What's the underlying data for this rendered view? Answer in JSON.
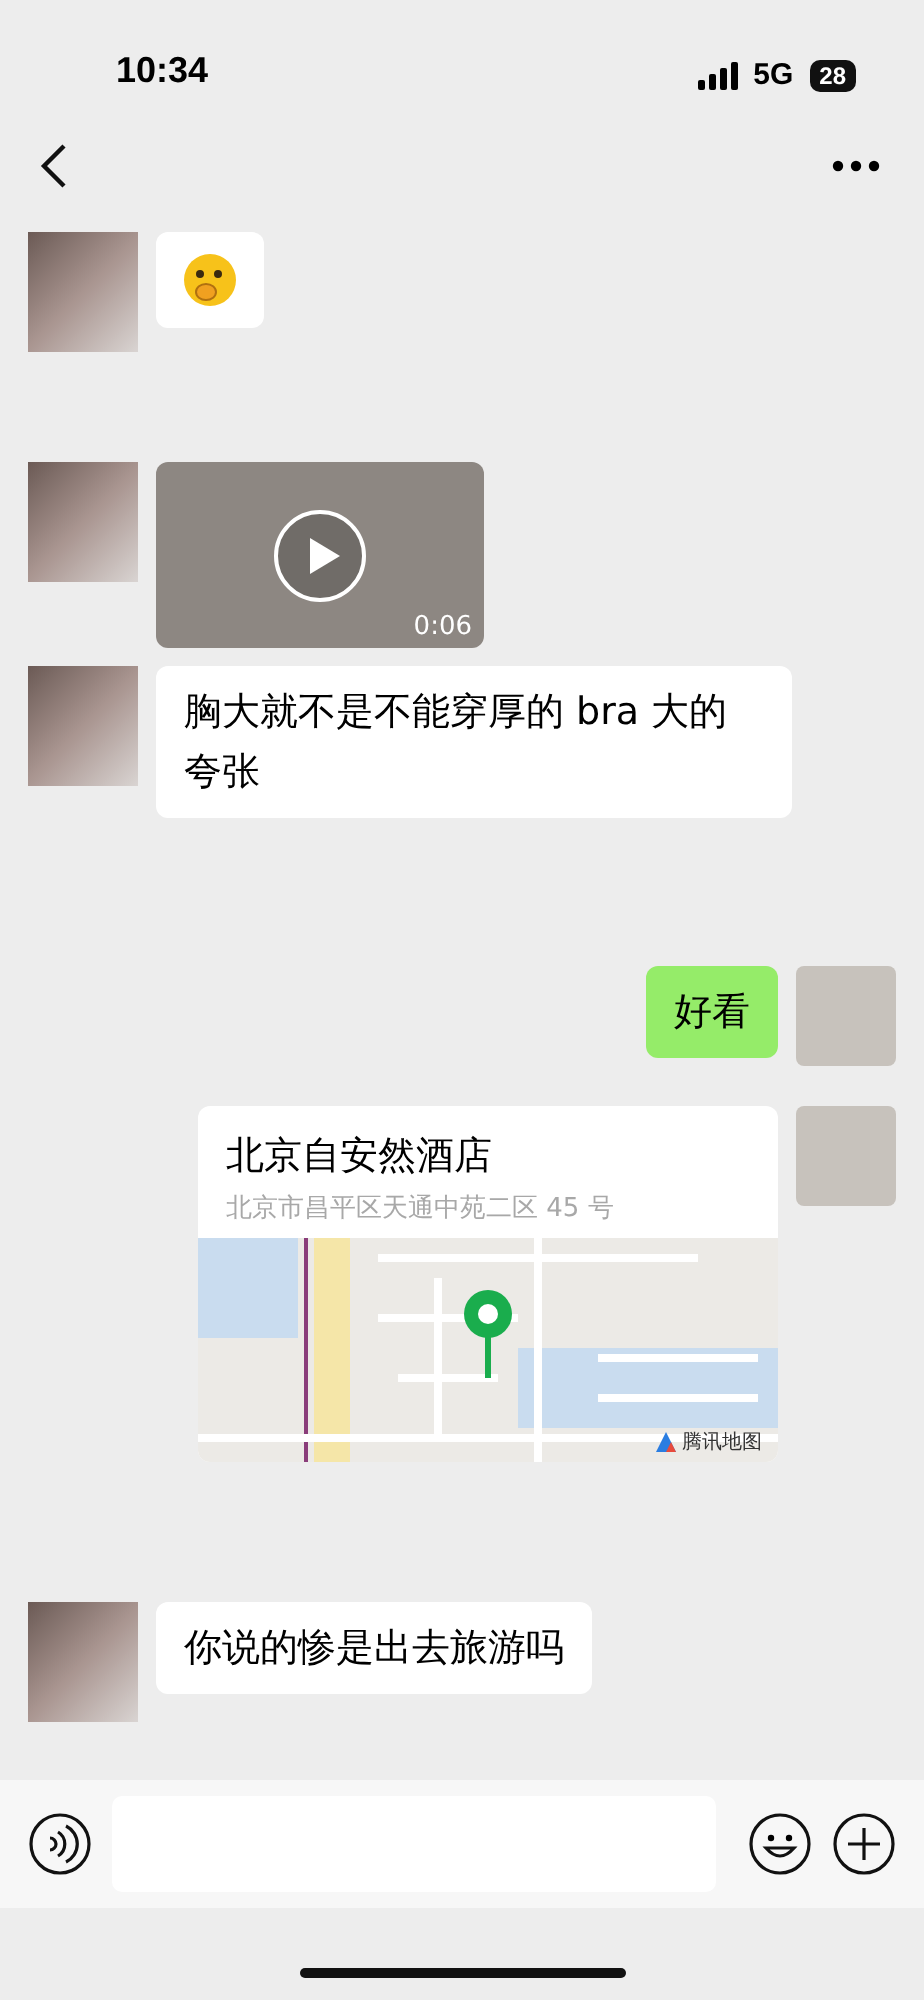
{
  "status_bar": {
    "time": "10:34",
    "network": "5G",
    "battery": "28"
  },
  "messages": [
    {
      "outgoing": false,
      "kind": "emoji"
    },
    {
      "outgoing": false,
      "kind": "video",
      "duration": "0:06"
    },
    {
      "outgoing": false,
      "kind": "text",
      "text": "胸大就不是不能穿厚的 bra 大的夸张"
    },
    {
      "outgoing": true,
      "kind": "text",
      "text": "好看"
    },
    {
      "outgoing": true,
      "kind": "location",
      "name": "北京自安然酒店",
      "address": "北京市昌平区天通中苑二区 45 号",
      "map_provider": "腾讯地图"
    },
    {
      "outgoing": false,
      "kind": "text",
      "text": "你说的惨是出去旅游吗"
    }
  ]
}
